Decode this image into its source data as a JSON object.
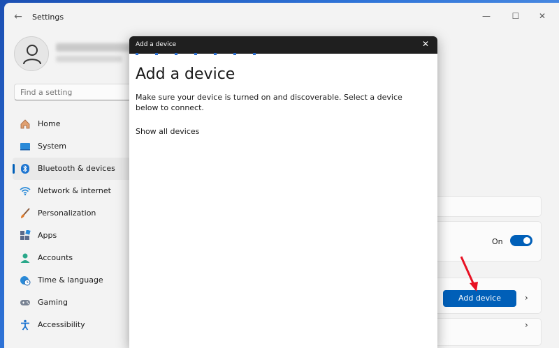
{
  "window": {
    "title": "Settings",
    "back_icon": "back-arrow-icon",
    "controls": {
      "minimize": "—",
      "maximize": "☐",
      "close": "✕"
    }
  },
  "search": {
    "placeholder": "Find a setting"
  },
  "sidebar": {
    "items": [
      {
        "label": "Home",
        "icon": "home-icon",
        "active": false
      },
      {
        "label": "System",
        "icon": "system-icon",
        "active": false
      },
      {
        "label": "Bluetooth & devices",
        "icon": "bluetooth-icon",
        "active": true
      },
      {
        "label": "Network & internet",
        "icon": "wifi-icon",
        "active": false
      },
      {
        "label": "Personalization",
        "icon": "brush-icon",
        "active": false
      },
      {
        "label": "Apps",
        "icon": "apps-icon",
        "active": false
      },
      {
        "label": "Accounts",
        "icon": "person-icon",
        "active": false
      },
      {
        "label": "Time & language",
        "icon": "globe-clock-icon",
        "active": false
      },
      {
        "label": "Gaming",
        "icon": "gamepad-icon",
        "active": false
      },
      {
        "label": "Accessibility",
        "icon": "accessibility-icon",
        "active": false
      }
    ]
  },
  "main": {
    "bluetooth_toggle": {
      "label": "On",
      "on": true
    },
    "add_device_button": "Add device",
    "chevron": "›"
  },
  "dialog": {
    "title_bar": "Add a device",
    "heading": "Add a device",
    "description": "Make sure your device is turned on and discoverable. Select a device below to connect.",
    "show_all": "Show all devices",
    "close": "✕"
  },
  "colors": {
    "accent": "#005fb8",
    "dialog_titlebar": "#1f1f1f",
    "arrow": "#e81123"
  }
}
